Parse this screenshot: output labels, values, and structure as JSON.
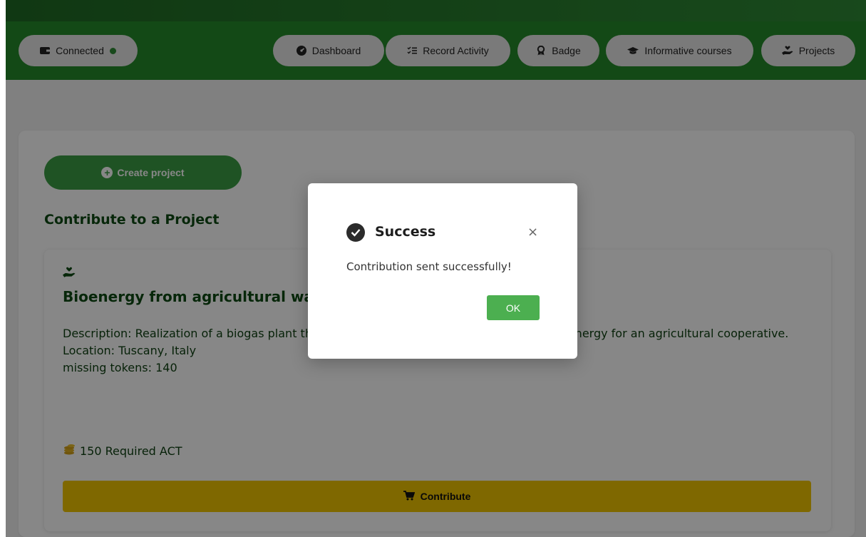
{
  "nav": {
    "wallet": {
      "label": "Connected",
      "status_color": "#2f8a35"
    },
    "items": [
      {
        "label": "Dashboard",
        "icon": "gauge-icon"
      },
      {
        "label": "Record Activity",
        "icon": "checklist-icon"
      },
      {
        "label": "Badge",
        "icon": "award-icon"
      },
      {
        "label": "Informative courses",
        "icon": "graduation-cap-icon"
      },
      {
        "label": "Projects",
        "icon": "hand-holding-heart-icon"
      }
    ]
  },
  "main": {
    "create_button": "Create project",
    "section_title": "Contribute to a Project",
    "project": {
      "title": "Bioenergy from agricultural waste",
      "description": "Description: Realization of a biogas plant that uses agricultural waste to generate clean energy for an agricultural cooperative.",
      "description_line1_left": "Description: Realization of a biogas pla",
      "description_line1_right": "nerate clean energy for an",
      "description_line2": "agricultural cooperative.",
      "location": "Location: Tuscany, Italy",
      "missing": "missing tokens: 140",
      "required": "150 Required ACT",
      "contribute_label": "Contribute"
    }
  },
  "modal": {
    "title": "Success",
    "message": "Contribution sent successfully!",
    "ok_label": "OK",
    "close_symbol": "×"
  },
  "colors": {
    "header_green": "#248a2b",
    "button_green": "#3c9e44",
    "title_green": "#0f4a14",
    "contribute_yellow": "#f0c400",
    "ok_green": "#4caf50"
  }
}
